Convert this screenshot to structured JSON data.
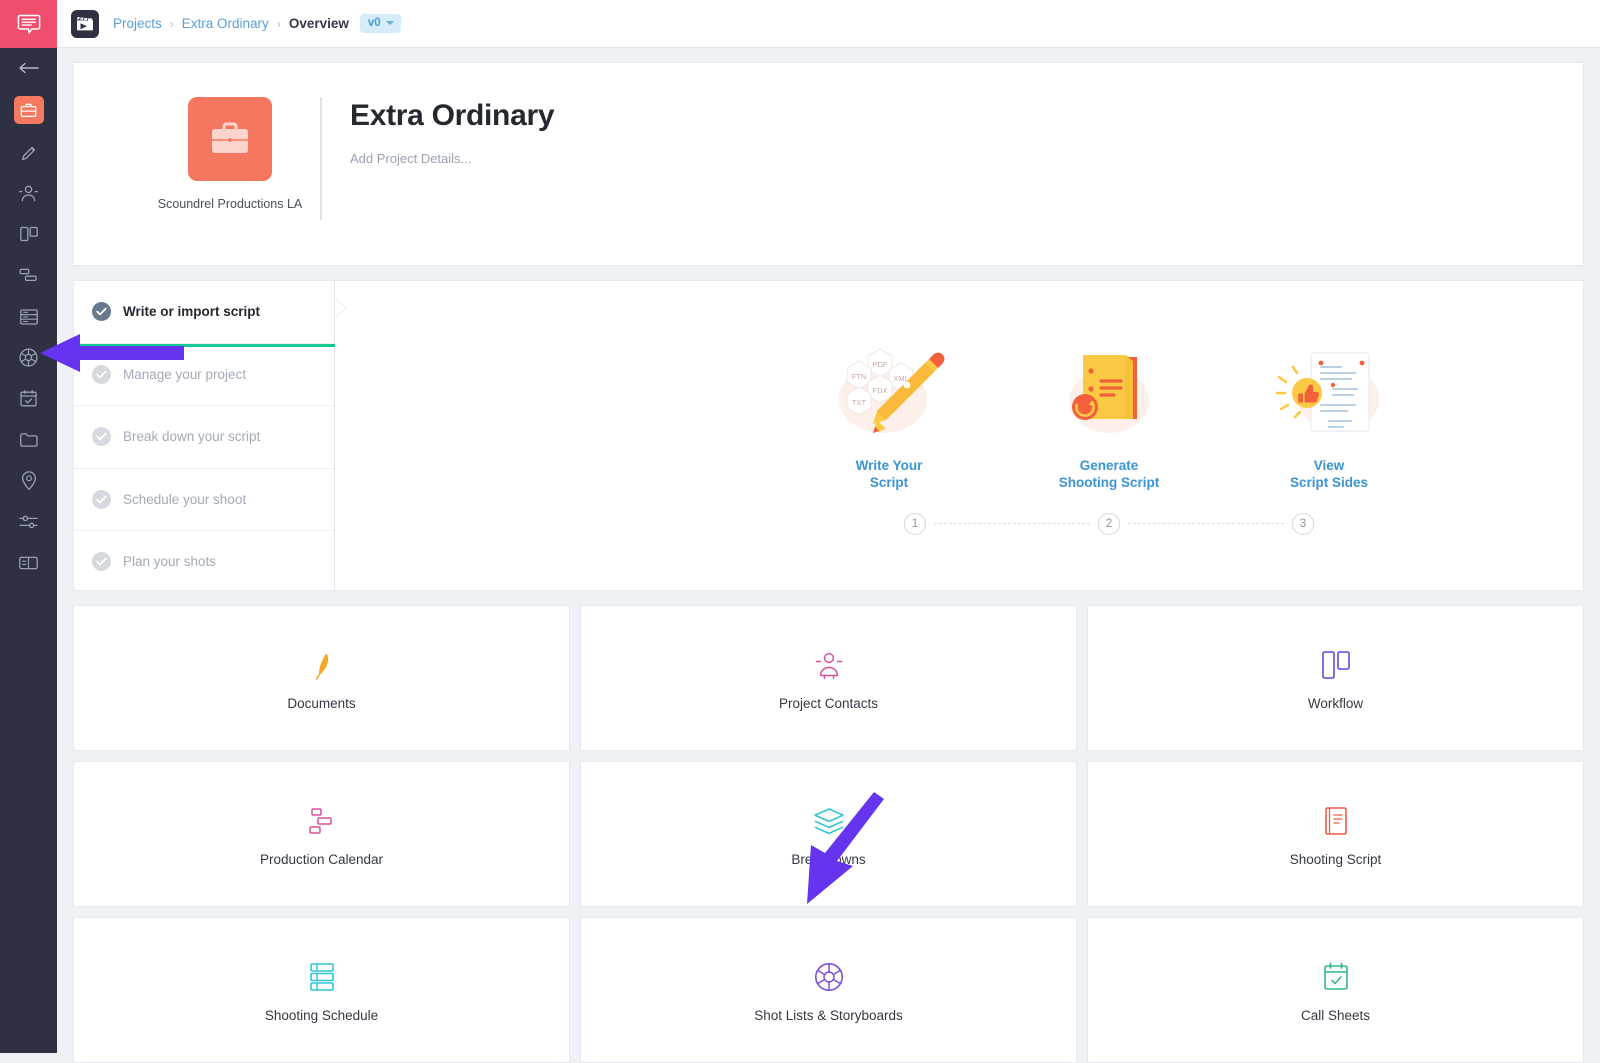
{
  "brand": {
    "rail_logo_icon": "speech-bubble-icon",
    "rail_logo_color": "#ef4e6d",
    "app_mark_icon": "clapperboard-icon",
    "rail_bg": "#2d3142",
    "accent_orange": "#f5775f",
    "accent_green": "#16c892",
    "link_blue": "#3a95d4",
    "annotation_purple": "#6633ee"
  },
  "rail": {
    "items": [
      {
        "name": "back-arrow-icon",
        "label": "Back",
        "active": false
      },
      {
        "name": "briefcase-icon",
        "label": "Project Overview",
        "active": true
      },
      {
        "name": "pencil-icon",
        "label": "Documents",
        "active": false
      },
      {
        "name": "people-icon",
        "label": "Project Contacts",
        "active": false
      },
      {
        "name": "workflow-icon",
        "label": "Workflow",
        "active": false
      },
      {
        "name": "gantt-icon",
        "label": "Production Calendar",
        "active": false
      },
      {
        "name": "layers-list-icon",
        "label": "Breakdowns",
        "active": false
      },
      {
        "name": "aperture-icon",
        "label": "Shot Lists & Storyboards",
        "active": false
      },
      {
        "name": "calendar-check-icon",
        "label": "Call Sheets",
        "active": false
      },
      {
        "name": "folder-icon",
        "label": "Files",
        "active": false
      },
      {
        "name": "location-pin-icon",
        "label": "Locations",
        "active": false
      },
      {
        "name": "sliders-icon",
        "label": "Settings",
        "active": false
      },
      {
        "name": "card-icon",
        "label": "Reports",
        "active": false
      }
    ]
  },
  "topbar": {
    "breadcrumb": [
      {
        "label": "Projects",
        "current": false
      },
      {
        "label": "Extra Ordinary",
        "current": false
      },
      {
        "label": "Overview",
        "current": true
      }
    ],
    "separator": "›",
    "version_badge": "v0"
  },
  "project": {
    "title": "Extra Ordinary",
    "subtitle": "Add Project Details...",
    "company": "Scoundrel Productions LA",
    "thumb_icon": "briefcase-icon"
  },
  "checklist": {
    "items": [
      {
        "label": "Write or import script",
        "done": true
      },
      {
        "label": "Manage your project",
        "done": false
      },
      {
        "label": "Break down your script",
        "done": false
      },
      {
        "label": "Schedule your shoot",
        "done": false
      },
      {
        "label": "Plan your shots",
        "done": false
      }
    ]
  },
  "steps": {
    "items": [
      {
        "line1": "Write Your",
        "line2": "Script",
        "number": "1",
        "art": "script-formats-pencil-art"
      },
      {
        "line1": "Generate",
        "line2": "Shooting Script",
        "number": "2",
        "art": "yellow-document-sync-art"
      },
      {
        "line1": "View",
        "line2": "Script Sides",
        "number": "3",
        "art": "script-page-thumbsup-art"
      }
    ],
    "format_badges": [
      "PDF",
      "FTN",
      "XML",
      "FDX",
      "TXT"
    ]
  },
  "tiles": [
    {
      "label": "Documents",
      "icon": "pencil-icon",
      "color": "#f5a623"
    },
    {
      "label": "Project Contacts",
      "icon": "people-icon",
      "color": "#d9509a"
    },
    {
      "label": "Workflow",
      "icon": "workflow-icon",
      "color": "#5b4ddb"
    },
    {
      "label": "Production Calendar",
      "icon": "gantt-icon",
      "color": "#d9509a"
    },
    {
      "label": "Breakdowns",
      "icon": "layers-icon",
      "color": "#2fc4d6"
    },
    {
      "label": "Shooting Script",
      "icon": "script-document-icon",
      "color": "#ef5b4c"
    },
    {
      "label": "Shooting Schedule",
      "icon": "schedule-grid-icon",
      "color": "#2fc4d6"
    },
    {
      "label": "Shot Lists & Storyboards",
      "icon": "aperture-icon",
      "color": "#7b4ddb"
    },
    {
      "label": "Call Sheets",
      "icon": "calendar-check-icon",
      "color": "#2fb98a"
    }
  ],
  "annotations": [
    {
      "name": "rail-aperture-pointer",
      "points_to": "aperture-icon in left rail",
      "direction": "left"
    },
    {
      "name": "shot-lists-tile-pointer",
      "points_to": "Shot Lists & Storyboards tile",
      "direction": "down-left"
    }
  ]
}
